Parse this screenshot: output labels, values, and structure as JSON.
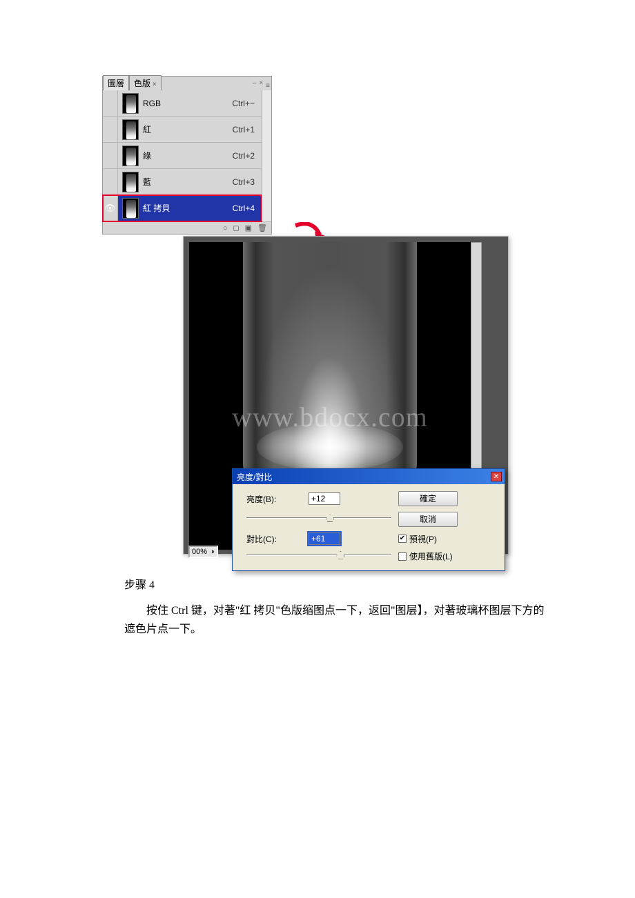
{
  "channels_panel": {
    "tabs": {
      "layers": "圖層",
      "channels": "色版",
      "close_x": "×"
    },
    "win": {
      "minus": "–",
      "close": "×",
      "menu": "≡"
    },
    "rows": [
      {
        "name": "RGB",
        "shortcut": "Ctrl+~",
        "visible": false,
        "selected": false
      },
      {
        "name": "紅",
        "shortcut": "Ctrl+1",
        "visible": false,
        "selected": false
      },
      {
        "name": "綠",
        "shortcut": "Ctrl+2",
        "visible": false,
        "selected": false
      },
      {
        "name": "藍",
        "shortcut": "Ctrl+3",
        "visible": false,
        "selected": false
      },
      {
        "name": "紅 拷貝",
        "shortcut": "Ctrl+4",
        "visible": true,
        "selected": true
      }
    ],
    "footer_icons": {
      "circle": "○",
      "mask": "◻",
      "new": "▣",
      "trash": "🗑"
    }
  },
  "watermark": "www.bdocx.com",
  "zoom": {
    "value": "00%",
    "icon": "◑"
  },
  "dialog": {
    "title": "亮度/對比",
    "brightness_label": "亮度(B):",
    "brightness_value": "+12",
    "contrast_label": "對比(C):",
    "contrast_value": "+61",
    "ok": "確定",
    "cancel": "取消",
    "preview_label": "預視(P)",
    "preview_checked": true,
    "legacy_label": "使用舊版(L)",
    "legacy_checked": false,
    "close_x": "✕",
    "slider1_pos": "55%",
    "slider2_pos": "62%"
  },
  "text": {
    "step": "步骤 4",
    "para": "按住 Ctrl 键，对著\"红 拷贝\"色版缩图点一下，返回\"图层】，对著玻璃杯图层下方的遮色片点一下。"
  }
}
